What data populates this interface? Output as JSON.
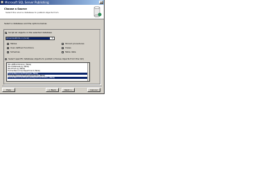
{
  "window": {
    "title": "Microsoft SQL Server Publishing",
    "close_glyph": "×"
  },
  "header": {
    "title": "Choose a Source",
    "subtitle": "Select the source database to publish objects from."
  },
  "instruction": "Select a database and the options below.",
  "source": {
    "option_label": "Script all objects in the selected database",
    "selected_database": "AdventureWorks on (local)"
  },
  "object_types": [
    {
      "label": "Tables",
      "checked": true
    },
    {
      "label": "Stored procedures",
      "checked": true
    },
    {
      "label": "User-defined functions",
      "checked": true
    },
    {
      "label": "Views",
      "checked": true
    },
    {
      "label": "Schemas",
      "checked": true
    },
    {
      "label": "Table data",
      "checked": false
    }
  ],
  "specific": {
    "option_label": "Select specific database objects to publish (choose objects from the list)"
  },
  "objects_list": [
    {
      "label": "dbo.AWBuildVersion (Table)",
      "selected": false
    },
    {
      "label": "dbo.DatabaseLog (Table)",
      "selected": false
    },
    {
      "label": "dbo.ErrorLog (Table)",
      "selected": false
    },
    {
      "label": "HumanResources.Department (Table)",
      "selected": false
    },
    {
      "label": "HumanResources.Employee (Table)",
      "selected": true
    },
    {
      "label": "HumanResources.EmployeeAddress (Table)",
      "selected": false
    },
    {
      "label": "HumanResources.EmployeeDepartmentHistory (Table)",
      "selected": true
    }
  ],
  "buttons": {
    "help": "Help",
    "back": "< Back",
    "next": "Next >",
    "cancel": "Cancel"
  },
  "colors": {
    "window_bg": "#d4d0c8",
    "titlebar_start": "#0a246a",
    "titlebar_end": "#a6caf0",
    "selection": "#0a246a"
  }
}
